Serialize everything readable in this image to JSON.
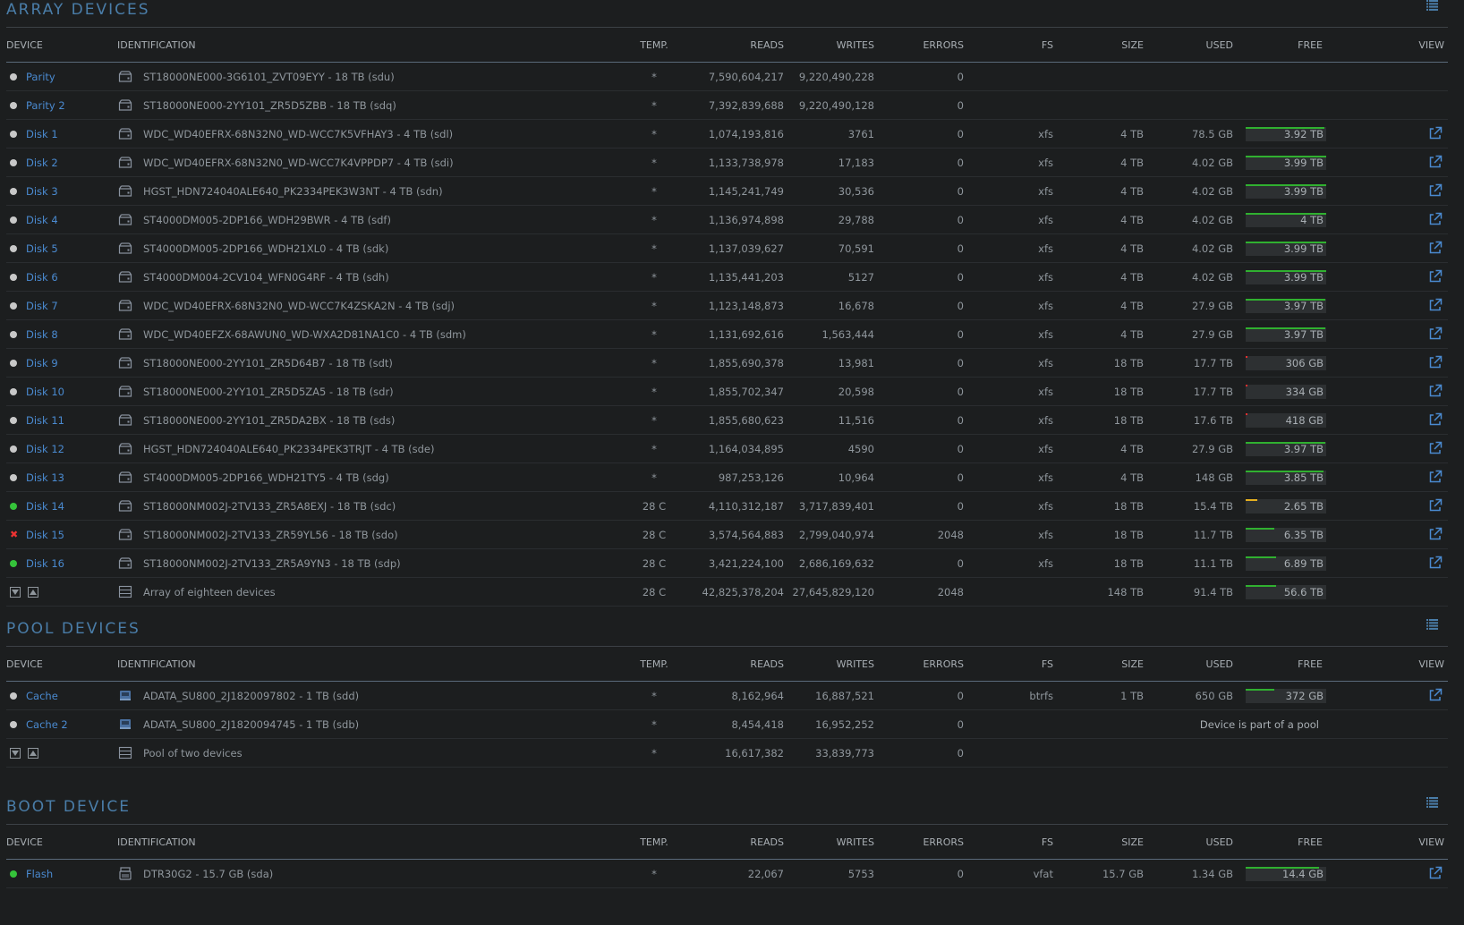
{
  "headers": {
    "device": "DEVICE",
    "identification": "IDENTIFICATION",
    "temp": "TEMP.",
    "reads": "READS",
    "writes": "WRITES",
    "errors": "ERRORS",
    "fs": "FS",
    "size": "SIZE",
    "used": "USED",
    "free": "FREE",
    "view": "VIEW"
  },
  "colors": {
    "accent": "#4a7da8",
    "link": "#4a8ad0",
    "status_green": "#35c33a",
    "status_standby": "#c8c8c8",
    "error_red": "#ee3333",
    "bar_green": "#30b030",
    "bar_yellow": "#e5b020",
    "bar_red": "#e03030"
  },
  "array": {
    "title": "ARRAY DEVICES",
    "rows": [
      {
        "status": "standby",
        "name": "Parity",
        "id": "ST18000NE000-3G6101_ZVT09EYY - 18 TB (sdu)",
        "temp": "*",
        "reads": "7,590,604,217",
        "writes": "9,220,490,228",
        "errors": "0",
        "fs": "",
        "size": "",
        "used": "",
        "free": "",
        "free_fraction": null,
        "bar_color": "",
        "view": false
      },
      {
        "status": "standby",
        "name": "Parity 2",
        "id": "ST18000NE000-2YY101_ZR5D5ZBB - 18 TB (sdq)",
        "temp": "*",
        "reads": "7,392,839,688",
        "writes": "9,220,490,128",
        "errors": "0",
        "fs": "",
        "size": "",
        "used": "",
        "free": "",
        "free_fraction": null,
        "bar_color": "",
        "view": false
      },
      {
        "status": "standby",
        "name": "Disk 1",
        "id": "WDC_WD40EFRX-68N32N0_WD-WCC7K5VFHAY3 - 4 TB (sdl)",
        "temp": "*",
        "reads": "1,074,193,816",
        "writes": "3761",
        "errors": "0",
        "fs": "xfs",
        "size": "4 TB",
        "used": "78.5 GB",
        "free": "3.92 TB",
        "free_fraction": 0.98,
        "bar_color": "green",
        "view": true
      },
      {
        "status": "standby",
        "name": "Disk 2",
        "id": "WDC_WD40EFRX-68N32N0_WD-WCC7K4VPPDP7 - 4 TB (sdi)",
        "temp": "*",
        "reads": "1,133,738,978",
        "writes": "17,183",
        "errors": "0",
        "fs": "xfs",
        "size": "4 TB",
        "used": "4.02 GB",
        "free": "3.99 TB",
        "free_fraction": 0.999,
        "bar_color": "green",
        "view": true
      },
      {
        "status": "standby",
        "name": "Disk 3",
        "id": "HGST_HDN724040ALE640_PK2334PEK3W3NT - 4 TB (sdn)",
        "temp": "*",
        "reads": "1,145,241,749",
        "writes": "30,536",
        "errors": "0",
        "fs": "xfs",
        "size": "4 TB",
        "used": "4.02 GB",
        "free": "3.99 TB",
        "free_fraction": 0.999,
        "bar_color": "green",
        "view": true
      },
      {
        "status": "standby",
        "name": "Disk 4",
        "id": "ST4000DM005-2DP166_WDH29BWR - 4 TB (sdf)",
        "temp": "*",
        "reads": "1,136,974,898",
        "writes": "29,788",
        "errors": "0",
        "fs": "xfs",
        "size": "4 TB",
        "used": "4.02 GB",
        "free": "4 TB",
        "free_fraction": 0.999,
        "bar_color": "green",
        "view": true
      },
      {
        "status": "standby",
        "name": "Disk 5",
        "id": "ST4000DM005-2DP166_WDH21XL0 - 4 TB (sdk)",
        "temp": "*",
        "reads": "1,137,039,627",
        "writes": "70,591",
        "errors": "0",
        "fs": "xfs",
        "size": "4 TB",
        "used": "4.02 GB",
        "free": "3.99 TB",
        "free_fraction": 0.999,
        "bar_color": "green",
        "view": true
      },
      {
        "status": "standby",
        "name": "Disk 6",
        "id": "ST4000DM004-2CV104_WFN0G4RF - 4 TB (sdh)",
        "temp": "*",
        "reads": "1,135,441,203",
        "writes": "5127",
        "errors": "0",
        "fs": "xfs",
        "size": "4 TB",
        "used": "4.02 GB",
        "free": "3.99 TB",
        "free_fraction": 0.999,
        "bar_color": "green",
        "view": true
      },
      {
        "status": "standby",
        "name": "Disk 7",
        "id": "WDC_WD40EFRX-68N32N0_WD-WCC7K4ZSKA2N - 4 TB (sdj)",
        "temp": "*",
        "reads": "1,123,148,873",
        "writes": "16,678",
        "errors": "0",
        "fs": "xfs",
        "size": "4 TB",
        "used": "27.9 GB",
        "free": "3.97 TB",
        "free_fraction": 0.993,
        "bar_color": "green",
        "view": true
      },
      {
        "status": "standby",
        "name": "Disk 8",
        "id": "WDC_WD40EFZX-68AWUN0_WD-WXA2D81NA1C0 - 4 TB (sdm)",
        "temp": "*",
        "reads": "1,131,692,616",
        "writes": "1,563,444",
        "errors": "0",
        "fs": "xfs",
        "size": "4 TB",
        "used": "27.9 GB",
        "free": "3.97 TB",
        "free_fraction": 0.993,
        "bar_color": "green",
        "view": true
      },
      {
        "status": "standby",
        "name": "Disk 9",
        "id": "ST18000NE000-2YY101_ZR5D64B7 - 18 TB (sdt)",
        "temp": "*",
        "reads": "1,855,690,378",
        "writes": "13,981",
        "errors": "0",
        "fs": "xfs",
        "size": "18 TB",
        "used": "17.7 TB",
        "free": "306 GB",
        "free_fraction": 0.017,
        "bar_color": "red",
        "view": true
      },
      {
        "status": "standby",
        "name": "Disk 10",
        "id": "ST18000NE000-2YY101_ZR5D5ZA5 - 18 TB (sdr)",
        "temp": "*",
        "reads": "1,855,702,347",
        "writes": "20,598",
        "errors": "0",
        "fs": "xfs",
        "size": "18 TB",
        "used": "17.7 TB",
        "free": "334 GB",
        "free_fraction": 0.019,
        "bar_color": "red",
        "view": true
      },
      {
        "status": "standby",
        "name": "Disk 11",
        "id": "ST18000NE000-2YY101_ZR5DA2BX - 18 TB (sds)",
        "temp": "*",
        "reads": "1,855,680,623",
        "writes": "11,516",
        "errors": "0",
        "fs": "xfs",
        "size": "18 TB",
        "used": "17.6 TB",
        "free": "418 GB",
        "free_fraction": 0.023,
        "bar_color": "red",
        "view": true
      },
      {
        "status": "standby",
        "name": "Disk 12",
        "id": "HGST_HDN724040ALE640_PK2334PEK3TRJT - 4 TB (sde)",
        "temp": "*",
        "reads": "1,164,034,895",
        "writes": "4590",
        "errors": "0",
        "fs": "xfs",
        "size": "4 TB",
        "used": "27.9 GB",
        "free": "3.97 TB",
        "free_fraction": 0.993,
        "bar_color": "green",
        "view": true
      },
      {
        "status": "standby",
        "name": "Disk 13",
        "id": "ST4000DM005-2DP166_WDH21TY5 - 4 TB (sdg)",
        "temp": "*",
        "reads": "987,253,126",
        "writes": "10,964",
        "errors": "0",
        "fs": "xfs",
        "size": "4 TB",
        "used": "148 GB",
        "free": "3.85 TB",
        "free_fraction": 0.963,
        "bar_color": "green",
        "view": true
      },
      {
        "status": "active",
        "name": "Disk 14",
        "id": "ST18000NM002J-2TV133_ZR5A8EXJ - 18 TB (sdc)",
        "temp": "28 C",
        "reads": "4,110,312,187",
        "writes": "3,717,839,401",
        "errors": "0",
        "fs": "xfs",
        "size": "18 TB",
        "used": "15.4 TB",
        "free": "2.65 TB",
        "free_fraction": 0.147,
        "bar_color": "yellow",
        "view": true
      },
      {
        "status": "error",
        "name": "Disk 15",
        "id": "ST18000NM002J-2TV133_ZR59YL56 - 18 TB (sdo)",
        "temp": "28 C",
        "reads": "3,574,564,883",
        "writes": "2,799,040,974",
        "errors": "2048",
        "fs": "xfs",
        "size": "18 TB",
        "used": "11.7 TB",
        "free": "6.35 TB",
        "free_fraction": 0.353,
        "bar_color": "green",
        "view": true
      },
      {
        "status": "active",
        "name": "Disk 16",
        "id": "ST18000NM002J-2TV133_ZR5A9YN3 - 18 TB (sdp)",
        "temp": "28 C",
        "reads": "3,421,224,100",
        "writes": "2,686,169,632",
        "errors": "0",
        "fs": "xfs",
        "size": "18 TB",
        "used": "11.1 TB",
        "free": "6.89 TB",
        "free_fraction": 0.383,
        "bar_color": "green",
        "view": true
      }
    ],
    "summary": {
      "label": "Array of eighteen devices",
      "temp": "28 C",
      "reads": "42,825,378,204",
      "writes": "27,645,829,120",
      "errors": "2048",
      "size": "148 TB",
      "used": "91.4 TB",
      "free": "56.6 TB",
      "free_fraction": 0.382
    }
  },
  "pool": {
    "title": "POOL DEVICES",
    "rows": [
      {
        "status": "standby",
        "name": "Cache",
        "id": "ADATA_SU800_2J1820097802 - 1 TB (sdd)",
        "temp": "*",
        "reads": "8,162,964",
        "writes": "16,887,521",
        "errors": "0",
        "fs": "btrfs",
        "size": "1 TB",
        "used": "650 GB",
        "free": "372 GB",
        "free_fraction": 0.36,
        "bar_color": "green",
        "view": true
      },
      {
        "status": "standby",
        "name": "Cache 2",
        "id": "ADATA_SU800_2J1820094745 - 1 TB (sdb)",
        "temp": "*",
        "reads": "8,454,418",
        "writes": "16,952,252",
        "errors": "0",
        "pool_note": "Device is part of a pool"
      }
    ],
    "summary": {
      "label": "Pool of two devices",
      "temp": "*",
      "reads": "16,617,382",
      "writes": "33,839,773",
      "errors": "0"
    }
  },
  "boot": {
    "title": "BOOT DEVICE",
    "rows": [
      {
        "status": "active",
        "name": "Flash",
        "id": "DTR30G2 - 15.7 GB (sda)",
        "temp": "*",
        "reads": "22,067",
        "writes": "5753",
        "errors": "0",
        "fs": "vfat",
        "size": "15.7 GB",
        "used": "1.34 GB",
        "free": "14.4 GB",
        "free_fraction": 0.915,
        "bar_color": "green",
        "view": true
      }
    ]
  }
}
